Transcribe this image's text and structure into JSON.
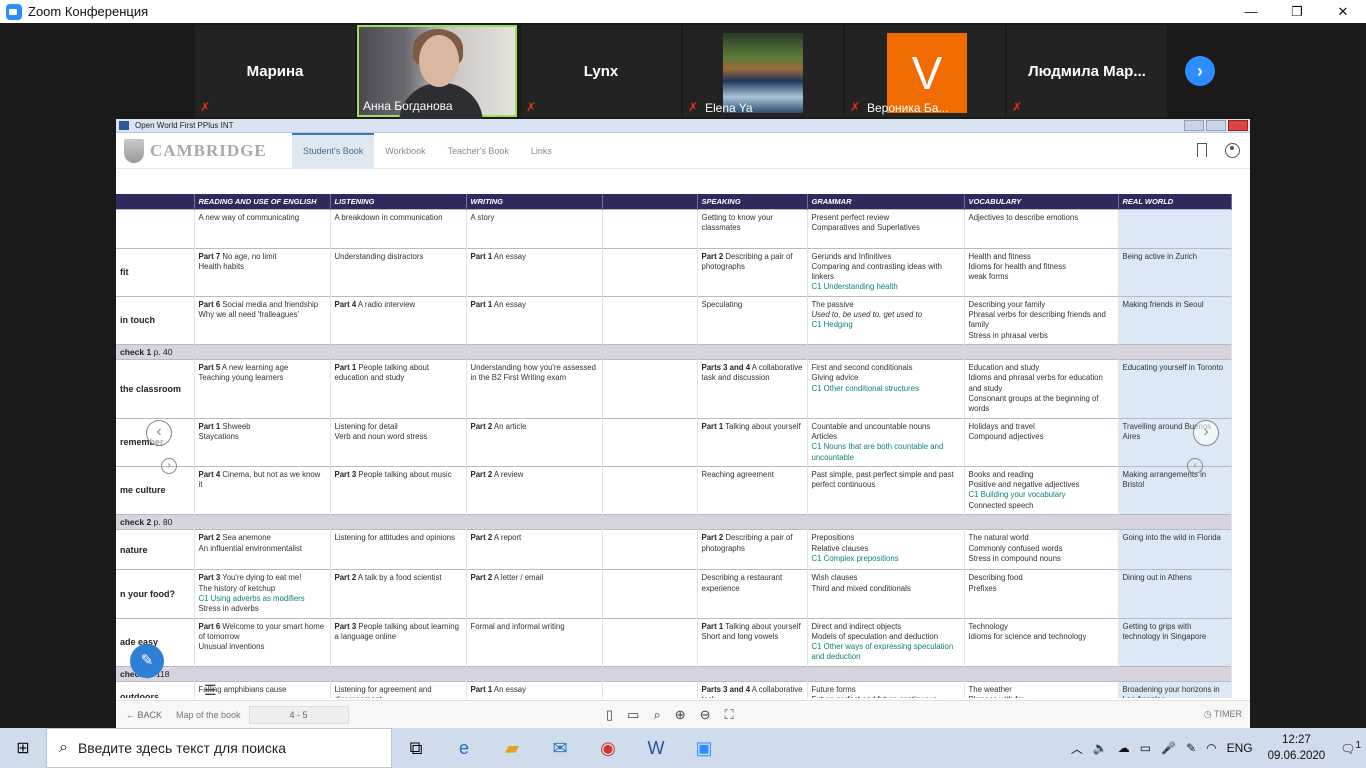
{
  "window": {
    "title": "Zoom Конференция",
    "minimize": "—",
    "maximize": "❐",
    "close": "✕"
  },
  "participants": [
    {
      "name": "Марина"
    },
    {
      "name": "Анна Богданова",
      "video": true
    },
    {
      "name": "Lynx"
    },
    {
      "name": "Elena Ya",
      "video": true
    },
    {
      "name": "Вероника Ба...",
      "avatar_letter": "V",
      "avatar_color": "#f06b00"
    },
    {
      "name": "Людмила  Мар..."
    }
  ],
  "shared_app": {
    "title": "Open World First PPlus INT",
    "brand": "CAMBRIDGE",
    "tabs": [
      "Student's Book",
      "Workbook",
      "Teacher's Book",
      "Links"
    ],
    "active_tab": "Student's Book"
  },
  "table": {
    "headers": [
      "READING AND USE OF ENGLISH",
      "LISTENING",
      "WRITING",
      "SPEAKING",
      "GRAMMAR",
      "VOCABULARY",
      "REAL WORLD"
    ],
    "rows": [
      {
        "type": "unit",
        "unit": "",
        "reading": "A new way of communicating",
        "listening": "A breakdown in communication",
        "writing": "A story",
        "speaking": "Getting to know your classmates",
        "grammar": "Present perfect review|Comparatives and Superlatives",
        "vocab": "Adjectives to describe emotions",
        "real": ""
      },
      {
        "type": "unit",
        "unit": "fit",
        "reading_b": "Part 7",
        "reading": "No age, no limit|Health habits",
        "listening": "Understanding distractors",
        "writing_b": "Part 1",
        "writing": "An essay",
        "speaking_b": "Part 2",
        "speaking": "Describing a pair of photographs",
        "grammar": "Gerunds and Infinitives|Comparing and contrasting ideas with linkers",
        "grammar_c1": "C1 Understanding health",
        "vocab": "Health and fitness|Idioms for health and fitness|weak forms",
        "real": "Being active in Zurich"
      },
      {
        "type": "unit",
        "unit": "in touch",
        "reading_b": "Part 6",
        "reading": "Social media and friendship|Why we all need 'fralleagues'",
        "listening_b": "Part 4",
        "listening": "A radio interview",
        "writing_b": "Part 1",
        "writing": "An essay",
        "speaking": "Speculating",
        "grammar": "The passive",
        "grammar_it": "Used to, be used to, get used to",
        "grammar_c1": "C1 Hedging",
        "vocab": "Describing your family|Phrasal verbs for describing friends and family|Stress in phrasal verbs",
        "real": "Making friends in Seoul"
      },
      {
        "type": "check",
        "label": "check 1",
        "page": "p. 40"
      },
      {
        "type": "unit",
        "unit": "the classroom",
        "reading_b": "Part 5",
        "reading": "A new learning age|Teaching young learners",
        "listening_b": "Part 1",
        "listening": "People talking about education and study",
        "writing": "Understanding how you're assessed in the B2 First Writing exam",
        "speaking_b": "Parts 3 and 4",
        "speaking": "A collaborative task and discussion",
        "grammar": "First and second conditionals|Giving advice",
        "grammar_c1": "C1 Other conditional structures",
        "vocab": "Education and study|Idioms and phrasal verbs for education and study|Consonant groups at the beginning of words",
        "real": "Educating yourself in Toronto"
      },
      {
        "type": "unit",
        "unit": "remember",
        "reading_b": "Part 1",
        "reading": "Shweeb|Staycations",
        "listening": "Listening for detail|Verb and noun word stress",
        "writing_b": "Part 2",
        "writing": "An article",
        "speaking_b": "Part 1",
        "speaking": "Talking about yourself",
        "grammar": "Countable and uncountable nouns|Articles",
        "grammar_c1": "C1 Nouns that are both countable and uncountable",
        "vocab": "Holidays and travel|Compound adjectives",
        "real": "Travelling around Buenos Aires"
      },
      {
        "type": "unit",
        "unit": "me culture",
        "reading_b": "Part 4",
        "reading": "Cinema, but not as we know it",
        "listening_b": "Part 3",
        "listening": "People talking about music",
        "writing_b": "Part 2",
        "writing": "A review",
        "speaking": "Reaching agreement",
        "grammar": "Past simple, past perfect simple and past perfect continuous",
        "vocab": "Books and reading|Positive and negative adjectives",
        "vocab_c1": "C1 Building your vocabulary",
        "vocab2": "Connected speech",
        "real": "Making arrangements in Bristol"
      },
      {
        "type": "check",
        "label": "check 2",
        "page": "p. 80"
      },
      {
        "type": "unit",
        "unit": "nature",
        "reading_b": "Part 2",
        "reading": "Sea anemone|An influential environmentalist",
        "listening": "Listening for attitudes and opinions",
        "writing_b": "Part 2",
        "writing": "A report",
        "speaking_b": "Part 2",
        "speaking": "Describing a pair of photographs",
        "grammar": "Prepositions|Relative clauses",
        "grammar_c1": "C1 Complex prepositions",
        "vocab": "The natural world|Commonly confused words|Stress in compound nouns",
        "real": "Going into the wild in Florida"
      },
      {
        "type": "unit",
        "unit": "n your food?",
        "reading_b": "Part 3",
        "reading": "You're dying to eat me!|The history of ketchup",
        "reading_c1": "C1 Using adverbs as modifiers",
        "reading2": "Stress in adverbs",
        "listening_b": "Part 2",
        "listening": "A talk by a food scientist",
        "writing_b": "Part 2",
        "writing": "A letter / email",
        "speaking": "Describing a restaurant experience",
        "grammar": "Wish clauses|Third and mixed conditionals",
        "vocab": "Describing food|Prefixes",
        "real": "Dining out in Athens"
      },
      {
        "type": "unit",
        "unit": "ade easy",
        "reading_b": "Part 6",
        "reading": "Welcome to your smart home of tomorrow|Unusual inventions",
        "listening_b": "Part 3",
        "listening": "People talking about learning a language online",
        "writing": "Formal and informal writing",
        "speaking_b": "Part 1",
        "speaking": "Talking about yourself|Short and long vowels",
        "grammar": "Direct and indirect objects|Models of speculation and deduction",
        "grammar_c1": "C1 Other ways of expressing speculation and deduction",
        "vocab": "Technology|Idioms for science and technology",
        "real": "Getting to grips with technology in Singapore"
      },
      {
        "type": "check",
        "label": "check",
        "page": "p. 118"
      },
      {
        "type": "unit",
        "unit": "outdoors",
        "reading": "Falling amphibians cause",
        "listening": "Listening for agreement and disagreement",
        "writing_b": "Part 1",
        "writing": "An essay",
        "speaking_b": "Parts 3 and 4",
        "speaking": "A collaborative task",
        "grammar": "Future forms|Future perfect and future continuous",
        "vocab": "The weather|Phrases with for",
        "real": "Broadening your horizons in Los Angeles"
      }
    ]
  },
  "bottom": {
    "back": "← BACK",
    "map": "Map of the book",
    "pages": "4 - 5",
    "timer": "TIMER"
  },
  "taskbar": {
    "search_placeholder": "Введите здесь текст для поиска",
    "lang": "ENG",
    "time": "12:27",
    "date": "09.06.2020",
    "notif": "1"
  }
}
